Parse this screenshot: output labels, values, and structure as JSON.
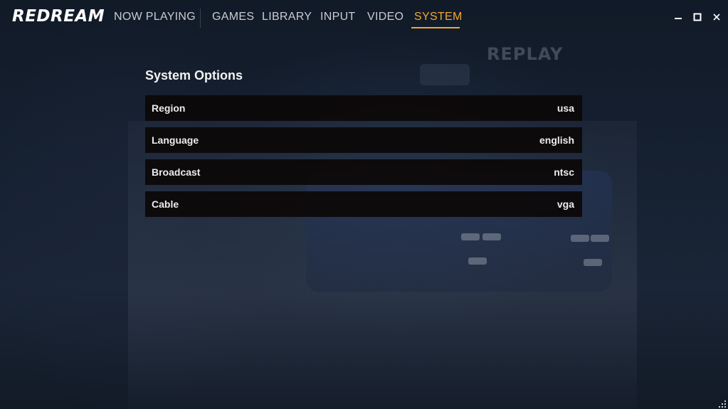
{
  "app": {
    "logo": "REDREAM"
  },
  "nav": {
    "items": [
      {
        "label": "NOW PLAYING"
      },
      {
        "label": "GAMES"
      },
      {
        "label": "LIBRARY"
      },
      {
        "label": "INPUT"
      },
      {
        "label": "VIDEO"
      },
      {
        "label": "SYSTEM"
      }
    ],
    "active": "SYSTEM"
  },
  "window_controls": [
    "minimize-icon",
    "maximize-icon",
    "close-icon"
  ],
  "background": {
    "watermark_text": "REPLAY"
  },
  "main": {
    "title": "System Options",
    "options": [
      {
        "label": "Region",
        "value": "usa"
      },
      {
        "label": "Language",
        "value": "english"
      },
      {
        "label": "Broadcast",
        "value": "ntsc"
      },
      {
        "label": "Cable",
        "value": "vga"
      }
    ]
  },
  "colors": {
    "accent": "#f0a830",
    "row_background": "#0c0808",
    "text": "#ececec"
  }
}
